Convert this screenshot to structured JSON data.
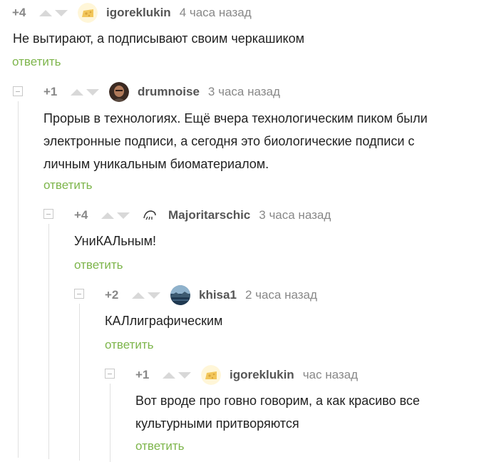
{
  "colors": {
    "reply_link": "#7db54b",
    "meta_text": "#888888",
    "username": "#555555",
    "body_text": "#222222",
    "thread_line": "#e0e0e0"
  },
  "comments": [
    {
      "rating": "+4",
      "username": "igoreklukin",
      "avatar_icon": "cheese-avatar",
      "time": "4 часа назад",
      "lines": [
        "Не вытирают, а подписывают своим черкашиком"
      ],
      "reply_label": "ответить"
    },
    {
      "rating": "+1",
      "username": "drumnoise",
      "avatar_icon": "man-portrait-avatar",
      "time": "3 часа назад",
      "lines": [
        "Прорыв в технологиях. Ещё вчера технологическим пиком были",
        "электронные подписи, а сегодня это биологические подписи с",
        "личным уникальным биоматериалом."
      ],
      "reply_label": "ответить"
    },
    {
      "rating": "+4",
      "username": "Majoritarschic",
      "avatar_icon": "sketch-face-avatar",
      "time": "3 часа назад",
      "lines": [
        "УниКАЛьным!"
      ],
      "reply_label": "ответить"
    },
    {
      "rating": "+2",
      "username": "khisa1",
      "avatar_icon": "landscape-avatar",
      "time": "2 часа назад",
      "lines": [
        "КАЛлиграфическим"
      ],
      "reply_label": "ответить"
    },
    {
      "rating": "+1",
      "username": "igoreklukin",
      "avatar_icon": "cheese-avatar",
      "time": "час назад",
      "lines": [
        "Вот вроде про говно говорим, а как красиво все",
        "культурными притворяются"
      ],
      "reply_label": "ответить"
    }
  ]
}
